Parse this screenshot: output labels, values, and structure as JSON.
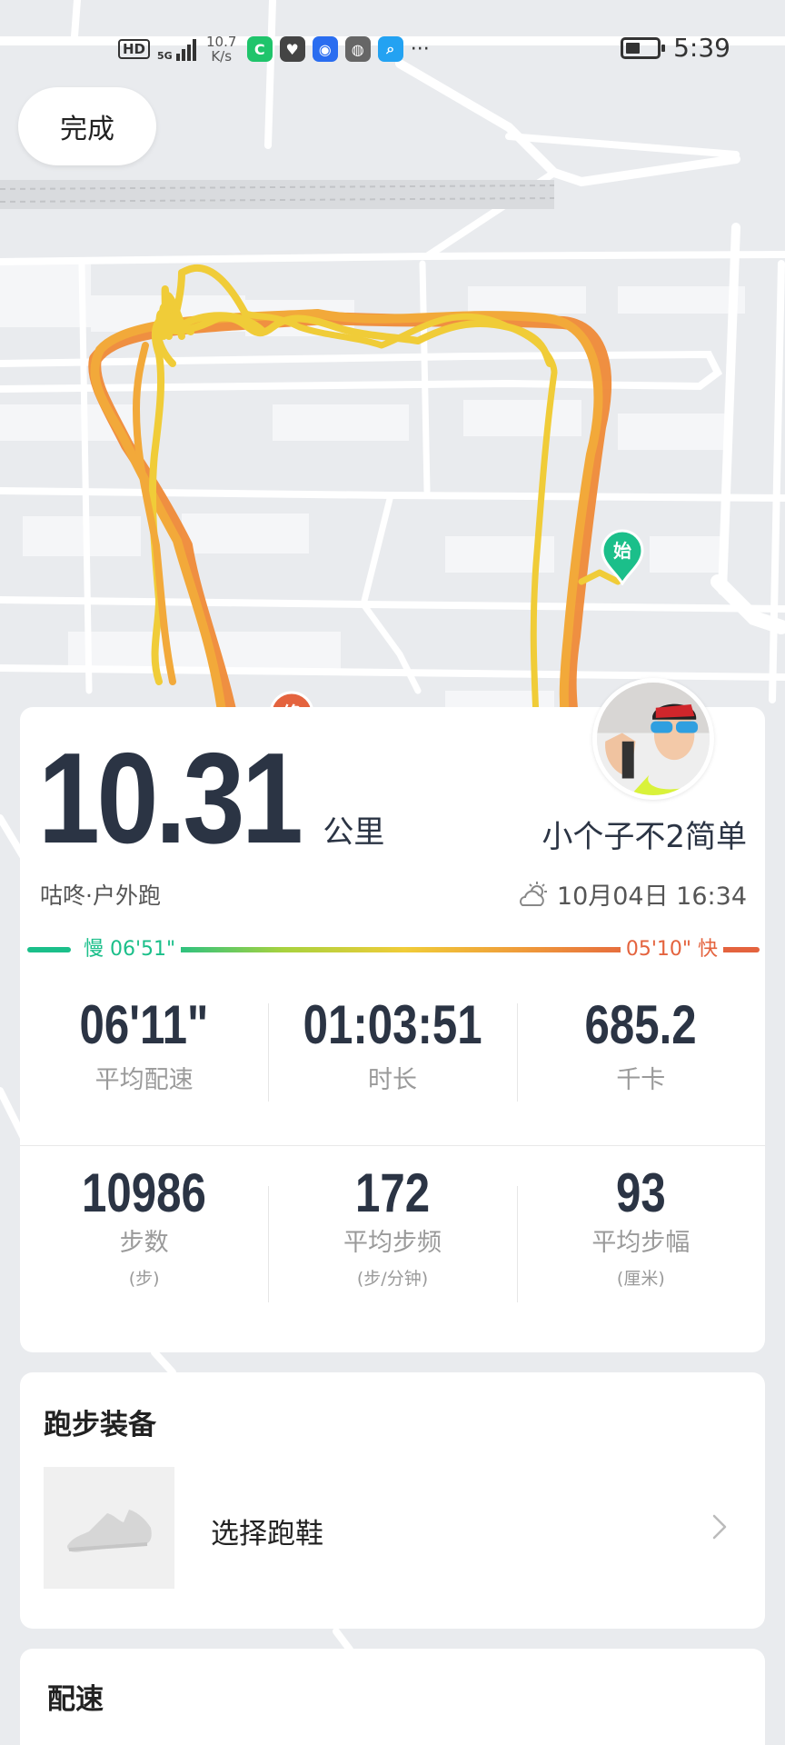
{
  "status_bar": {
    "hd_tag": "HD",
    "network": "5G",
    "speed_value": "10.7",
    "speed_unit": "K/s",
    "more": "···",
    "time": "5:39",
    "battery_level": 0.45,
    "app_icons": [
      {
        "name": "app-icon-green",
        "color": "#1fc46b",
        "glyph": "C"
      },
      {
        "name": "health-icon",
        "color": "#444444",
        "glyph": "♥"
      },
      {
        "name": "app-icon-bulb",
        "color": "#2a6df0",
        "glyph": "◉"
      },
      {
        "name": "browser-icon",
        "color": "#666666",
        "glyph": "◍"
      },
      {
        "name": "search-app-icon",
        "color": "#23a2f2",
        "glyph": "⌕"
      }
    ]
  },
  "header": {
    "done_label": "完成"
  },
  "map": {
    "start_label": "始",
    "end_label": "终",
    "route_colors": [
      "#f0cc38",
      "#f0a638",
      "#ee8a36"
    ]
  },
  "summary": {
    "distance": "10.31",
    "distance_unit": "公里",
    "username": "小个子不2简单",
    "device_type": "咕咚·户外跑",
    "datetime": "10月04日 16:34",
    "pace_slow": "慢 06'51\"",
    "pace_fast": "05'10\" 快",
    "stats_row1": [
      {
        "value": "06'11\"",
        "label": "平均配速"
      },
      {
        "value": "01:03:51",
        "label": "时长"
      },
      {
        "value": "685.2",
        "label": "千卡"
      }
    ],
    "stats_row2": [
      {
        "value": "10986",
        "label": "步数",
        "unit": "(步)"
      },
      {
        "value": "172",
        "label": "平均步频",
        "unit": "(步/分钟)"
      },
      {
        "value": "93",
        "label": "平均步幅",
        "unit": "(厘米)"
      }
    ]
  },
  "equipment": {
    "title": "跑步装备",
    "select_shoe": "选择跑鞋"
  },
  "pace_section": {
    "title": "配速"
  },
  "colors": {
    "slow": "#1bbf8a",
    "fast": "#e4633e",
    "text_dark": "#2b3444",
    "pin_start": "#1bbf8a",
    "pin_end": "#e4633e"
  }
}
